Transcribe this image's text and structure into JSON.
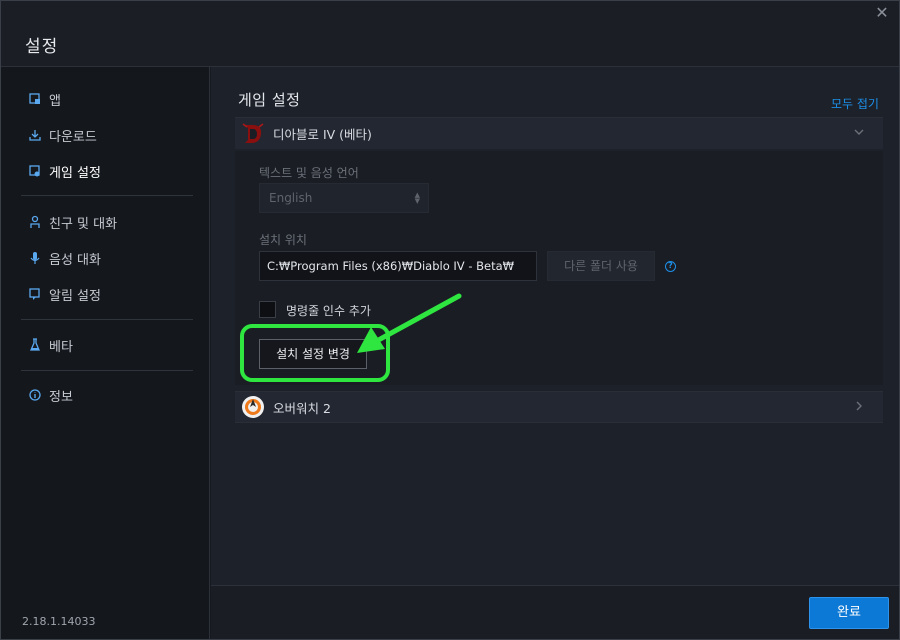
{
  "window": {
    "title": "설정"
  },
  "sidebar": {
    "items": [
      {
        "label": "앱",
        "icon": "app-icon"
      },
      {
        "label": "다운로드",
        "icon": "download-icon"
      },
      {
        "label": "게임 설정",
        "icon": "game-settings-icon",
        "active": true
      },
      {
        "label": "친구 및 대화",
        "icon": "friends-icon"
      },
      {
        "label": "음성 대화",
        "icon": "microphone-icon"
      },
      {
        "label": "알림 설정",
        "icon": "notification-icon"
      },
      {
        "label": "베타",
        "icon": "beaker-icon"
      },
      {
        "label": "정보",
        "icon": "info-icon"
      }
    ],
    "version": "2.18.1.14033"
  },
  "main": {
    "section_title": "게임 설정",
    "collapse_all": "모두 접기",
    "games": [
      {
        "name": "디아블로 IV (베타)",
        "icon": "diablo-logo",
        "expanded": true,
        "language_label": "텍스트 및 음성 언어",
        "language_value": "English",
        "install_label": "설치 위치",
        "install_path": "C:₩Program Files (x86)₩Diablo IV - Beta₩",
        "other_folder_button": "다른 폴더 사용",
        "cmd_args_label": "명령줄 인수 추가",
        "change_button": "설치 설정 변경"
      },
      {
        "name": "오버워치 2",
        "icon": "overwatch-logo",
        "expanded": false
      }
    ]
  },
  "footer": {
    "done_button": "완료"
  },
  "colors": {
    "accent": "#1d8fe8",
    "highlight": "#2ee63f",
    "primary_button": "#0d79d6"
  }
}
